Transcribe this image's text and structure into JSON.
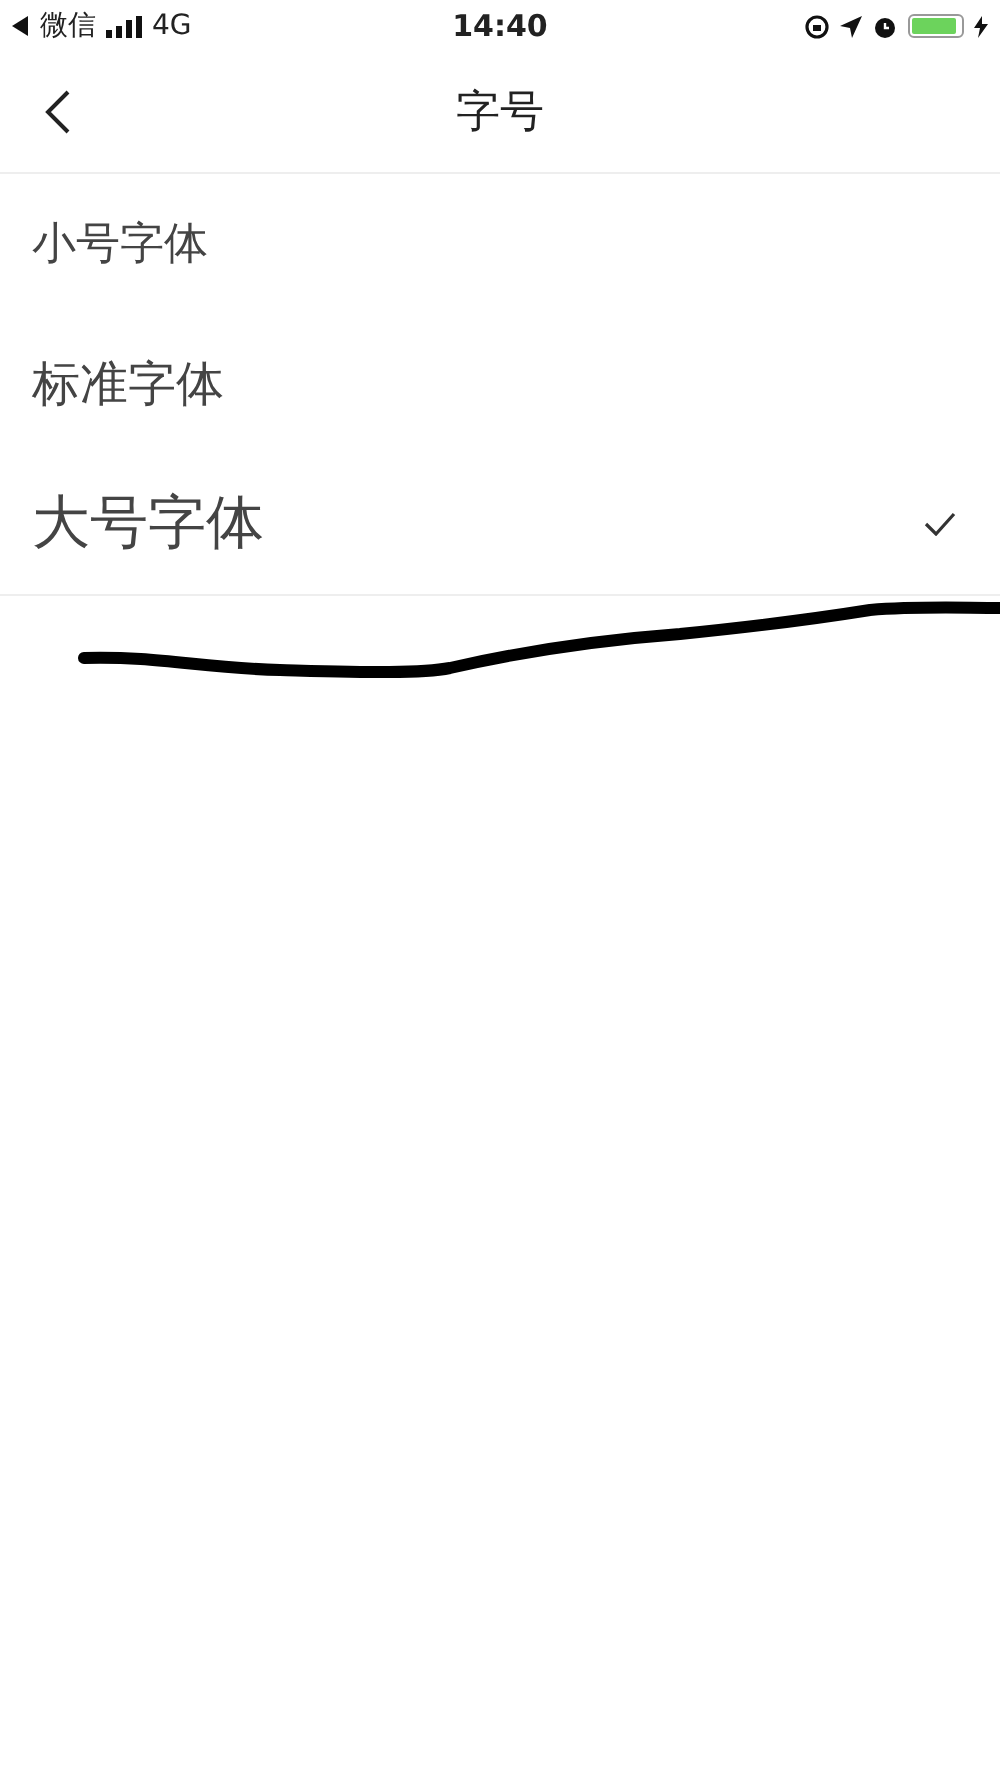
{
  "status_bar": {
    "back_app": "微信",
    "network": "4G",
    "time": "14:40"
  },
  "nav": {
    "title": "字号"
  },
  "options": [
    {
      "label": "小号字体",
      "kind": "small",
      "selected": false
    },
    {
      "label": "标准字体",
      "kind": "standard",
      "selected": false
    },
    {
      "label": "大号字体",
      "kind": "large",
      "selected": true
    }
  ]
}
